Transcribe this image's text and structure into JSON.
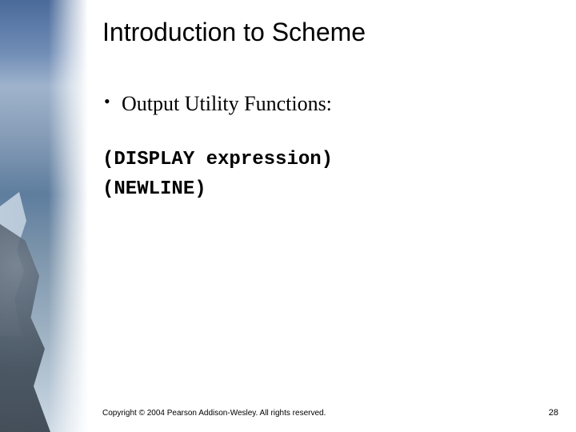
{
  "title": "Introduction to Scheme",
  "bullet": "Output Utility Functions:",
  "code": {
    "line1": "(DISPLAY expression)",
    "line2": "(NEWLINE)"
  },
  "footer": "Copyright © 2004 Pearson Addison-Wesley. All rights reserved.",
  "page_number": "28"
}
